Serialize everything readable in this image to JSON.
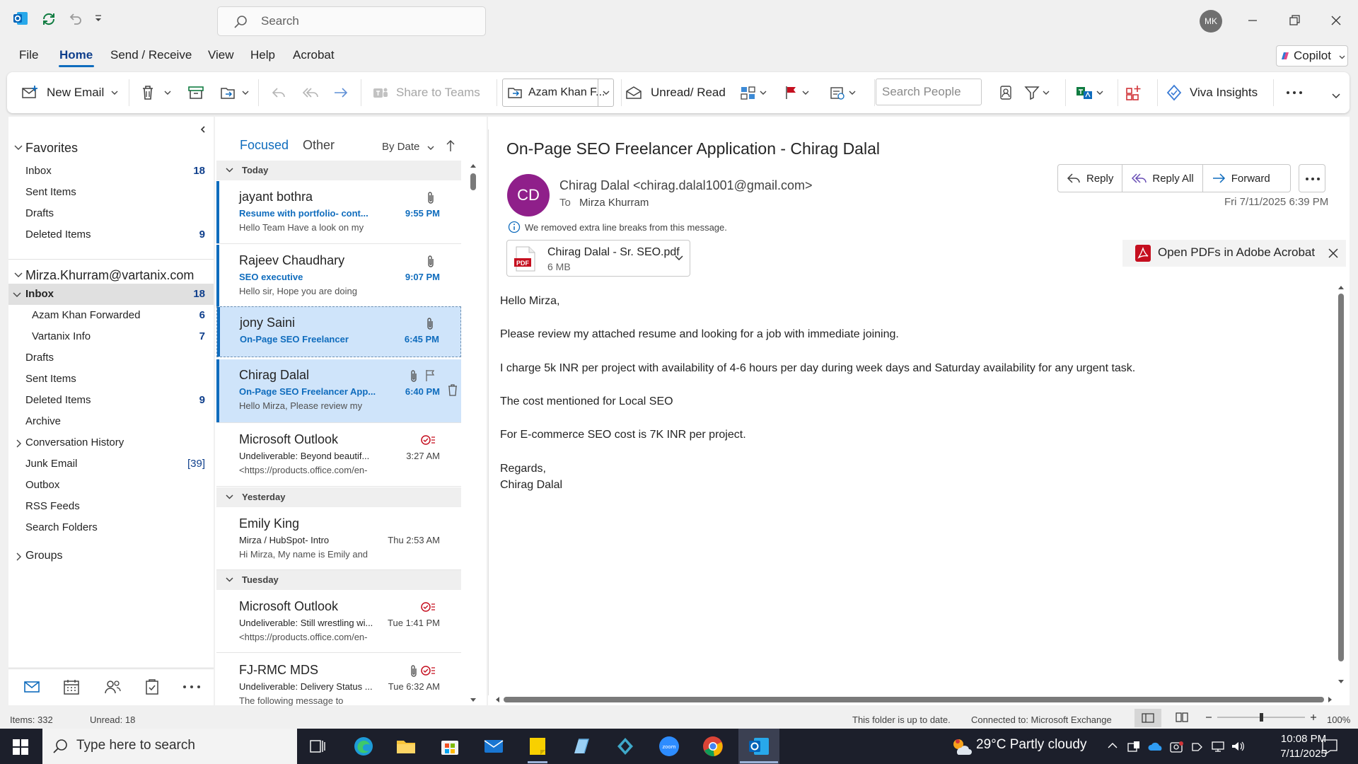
{
  "titlebar": {
    "search_placeholder": "Search",
    "avatar_initials": "MK"
  },
  "menu": {
    "tabs": [
      "File",
      "Home",
      "Send / Receive",
      "View",
      "Help",
      "Acrobat"
    ],
    "copilot": "Copilot"
  },
  "ribbon": {
    "new_email": "New Email",
    "share_to_teams": "Share to Teams",
    "move_to": "Azam Khan F...",
    "unread_read": "Unread/ Read",
    "search_people_placeholder": "Search People",
    "viva_insights": "Viva Insights"
  },
  "nav": {
    "favorites": {
      "header": "Favorites",
      "items": [
        {
          "label": "Inbox",
          "count": "18"
        },
        {
          "label": "Sent Items",
          "count": ""
        },
        {
          "label": "Drafts",
          "count": ""
        },
        {
          "label": "Deleted Items",
          "count": "9"
        }
      ]
    },
    "account": {
      "header": "Mirza.Khurram@vartanix.com",
      "inbox": {
        "label": "Inbox",
        "count": "18"
      },
      "subfolders": [
        {
          "label": "Azam Khan Forwarded",
          "count": "6"
        },
        {
          "label": "Vartanix Info",
          "count": "7"
        }
      ],
      "items": [
        {
          "label": "Drafts",
          "count": ""
        },
        {
          "label": "Sent Items",
          "count": ""
        },
        {
          "label": "Deleted Items",
          "count": "9"
        },
        {
          "label": "Archive",
          "count": ""
        },
        {
          "label": "Conversation History",
          "count": ""
        },
        {
          "label": "Junk Email",
          "count": "[39]"
        },
        {
          "label": "Outbox",
          "count": ""
        },
        {
          "label": "RSS Feeds",
          "count": ""
        },
        {
          "label": "Search Folders",
          "count": ""
        }
      ]
    },
    "groups": "Groups"
  },
  "list": {
    "tab_focused": "Focused",
    "tab_other": "Other",
    "sort": "By Date",
    "groups": {
      "today": "Today",
      "yesterday": "Yesterday",
      "tuesday": "Tuesday"
    },
    "mails": [
      {
        "sender": "jayant bothra",
        "subject": "Resume with portfolio- cont...",
        "preview": "Hello Team  Have a look on my",
        "time": "9:55 PM"
      },
      {
        "sender": "Rajeev Chaudhary",
        "subject": "SEO executive",
        "preview": "Hello sir,  Hope you are doing",
        "time": "9:07 PM"
      },
      {
        "sender": "jony Saini",
        "subject": "On-Page SEO Freelancer",
        "preview": "",
        "time": "6:45 PM"
      },
      {
        "sender": "Chirag Dalal",
        "subject": "On-Page SEO Freelancer App...",
        "preview": "Hello Mirza,  Please review my",
        "time": "6:40 PM"
      },
      {
        "sender": "Microsoft Outlook",
        "subject": "Undeliverable: Beyond beautif...",
        "preview": "<https://products.office.com/en-",
        "time": "3:27 AM"
      },
      {
        "sender": "Emily King",
        "subject": "Mirza / HubSpot- Intro",
        "preview": "Hi Mirza,  My name is Emily and",
        "time": "Thu 2:53 AM"
      },
      {
        "sender": "Microsoft Outlook",
        "subject": "Undeliverable: Still wrestling wi...",
        "preview": "<https://products.office.com/en-",
        "time": "Tue 1:41 PM"
      },
      {
        "sender": "FJ-RMC MDS",
        "subject": "Undeliverable: Delivery Status ...",
        "preview": "The following message to",
        "time": "Tue 6:32 AM"
      }
    ]
  },
  "reading": {
    "subject": "On-Page SEO Freelancer Application - Chirag Dalal",
    "avatar": "CD",
    "from": "Chirag Dalal <chirag.dalal1001@gmail.com>",
    "to_label": "To",
    "to": "Mirza Khurram",
    "reply": "Reply",
    "reply_all": "Reply All",
    "forward": "Forward",
    "date": "Fri 7/11/2025 6:39 PM",
    "info": "We removed extra line breaks from this message.",
    "attachment": {
      "name": "Chirag Dalal - Sr. SEO.pdf",
      "size": "6 MB",
      "type": "PDF"
    },
    "pdf_banner": "Open PDFs in Adobe Acrobat",
    "body": [
      "Hello Mirza,",
      "Please review my attached resume and looking for a job with immediate joining.",
      "I charge 5k INR per project with availability of 4-6 hours per day during week days and Saturday availability for any urgent task.",
      "The cost mentioned for Local SEO",
      "For E-commerce SEO cost is 7K INR per project.",
      "Regards,",
      "Chirag Dalal"
    ]
  },
  "status": {
    "items": "Items: 332",
    "unread": "Unread: 18",
    "sync": "This folder is up to date.",
    "connection": "Connected to: Microsoft Exchange",
    "zoom": "100%"
  },
  "taskbar": {
    "search_placeholder": "Type here to search",
    "weather": "29°C  Partly cloudy",
    "time": "10:08 PM",
    "date": "7/11/2025"
  },
  "colors": {
    "accent": "#0f6cbd",
    "selected_mail": "#cfe4fa",
    "avatar_cd": "#8f1f8a",
    "flag": "#c50f1f"
  }
}
